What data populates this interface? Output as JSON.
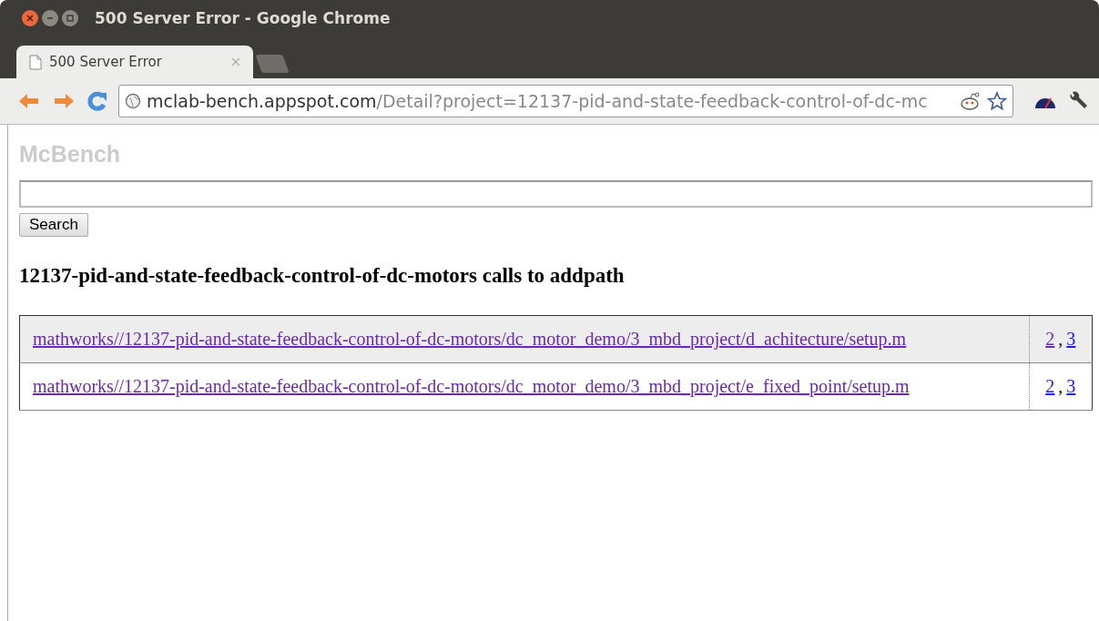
{
  "window": {
    "title": "500 Server Error - Google Chrome"
  },
  "tabs": [
    {
      "label": "500 Server Error",
      "selected": true
    }
  ],
  "address_bar": {
    "host": "mclab-bench.appspot.com",
    "path": "/Detail?project=12137-pid-and-state-feedback-control-of-dc-mc"
  },
  "page": {
    "logo": "McBench",
    "search": {
      "button": "Search"
    },
    "heading": "12137-pid-and-state-feedback-control-of-dc-motors calls to addpath",
    "rows": [
      {
        "path": {
          "text": "mathworks//12137-pid-and-state-feedback-control-of-dc-motors/dc_motor_demo/3_mbd_project/d_achitecture/setup.m",
          "visited": true
        },
        "selected": true,
        "separator": ",",
        "lines": [
          {
            "text": "2",
            "visited": true
          },
          {
            "text": "3",
            "visited": false
          }
        ]
      },
      {
        "path": {
          "text": "mathworks//12137-pid-and-state-feedback-control-of-dc-motors/dc_motor_demo/3_mbd_project/e_fixed_point/setup.m",
          "visited": true
        },
        "selected": false,
        "separator": ",",
        "lines": [
          {
            "text": "2",
            "visited": false
          },
          {
            "text": "3",
            "visited": false
          }
        ]
      }
    ]
  }
}
